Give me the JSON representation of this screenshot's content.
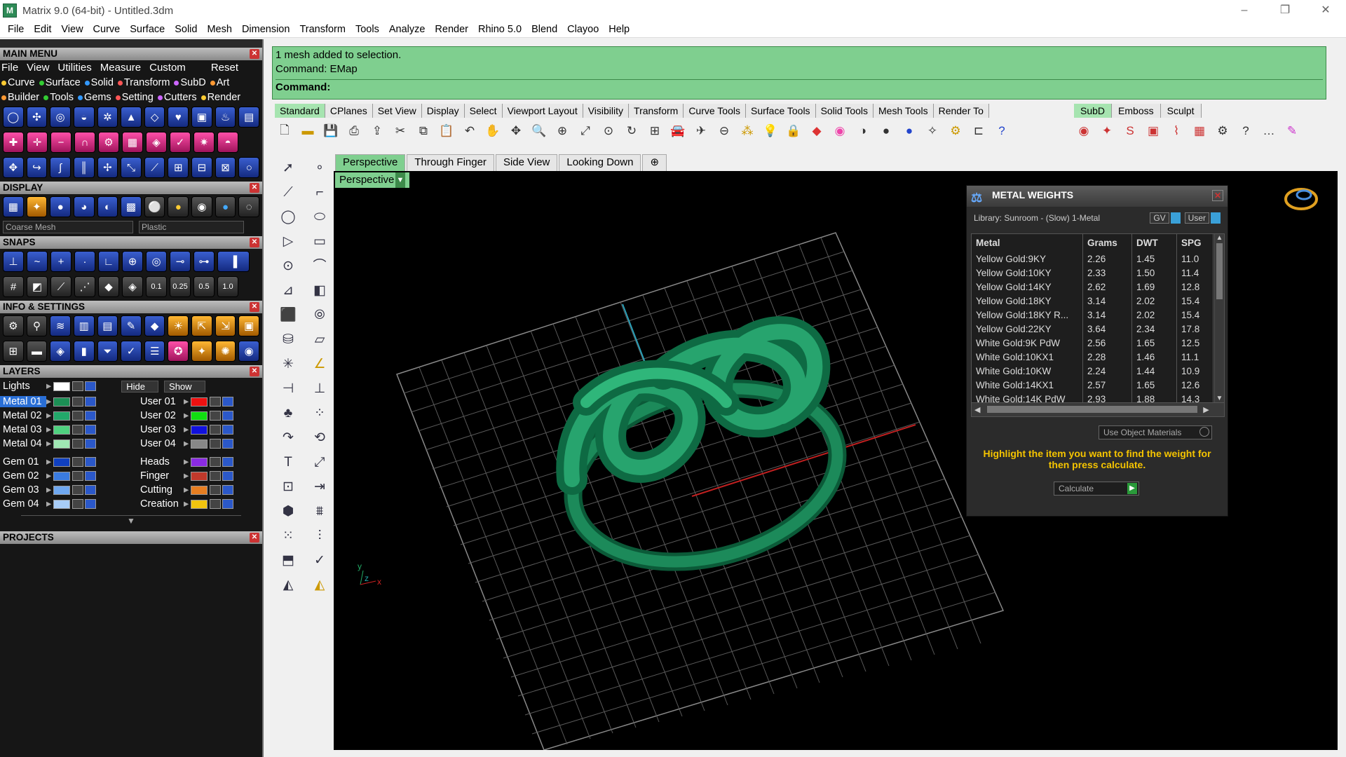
{
  "window": {
    "title": "Matrix 9.0 (64-bit) - Untitled.3dm"
  },
  "menus": [
    "File",
    "Edit",
    "View",
    "Curve",
    "Surface",
    "Solid",
    "Mesh",
    "Dimension",
    "Transform",
    "Tools",
    "Analyze",
    "Render",
    "Rhino 5.0",
    "Blend",
    "Clayoo",
    "Help"
  ],
  "left": {
    "main_menu": "MAIN MENU",
    "main_menu_items": [
      "File",
      "View",
      "Utilities",
      "Measure",
      "Custom",
      "Reset"
    ],
    "row2": [
      "Curve",
      "Surface",
      "Solid",
      "Transform",
      "SubD",
      "Art"
    ],
    "row3": [
      "Builder",
      "Tools",
      "Gems",
      "Setting",
      "Cutters",
      "Render"
    ],
    "display": "DISPLAY",
    "mesh_sel": "Coarse Mesh",
    "mat_sel": "Plastic",
    "snaps": "SNAPS",
    "snap_vals": [
      "0.1",
      "0.25",
      "0.5",
      "1.0"
    ],
    "info": "INFO & SETTINGS",
    "layers": "LAYERS",
    "lights": "Lights",
    "hide": "Hide",
    "show": "Show",
    "layers_left": [
      "Metal 01",
      "Metal 02",
      "Metal 03",
      "Metal 04",
      "Gem 01",
      "Gem 02",
      "Gem 03",
      "Gem 04"
    ],
    "layers_right": [
      "User 01",
      "User 02",
      "User 03",
      "User 04",
      "Heads",
      "Finger",
      "Cutting",
      "Creation"
    ],
    "projects": "PROJECTS"
  },
  "cmd": {
    "line1": "1 mesh added to selection.",
    "line2": "Command: EMap",
    "prompt": "Command:"
  },
  "tabs": [
    "Standard",
    "CPlanes",
    "Set View",
    "Display",
    "Select",
    "Viewport Layout",
    "Visibility",
    "Transform",
    "Curve Tools",
    "Surface Tools",
    "Solid Tools",
    "Mesh Tools",
    "Render To"
  ],
  "tabs2": [
    "SubD",
    "Emboss",
    "Sculpt"
  ],
  "vptabs": [
    "Perspective",
    "Through Finger",
    "Side View",
    "Looking Down"
  ],
  "vp_label": "Perspective",
  "mw": {
    "title": "METAL WEIGHTS",
    "library": "Library: Sunroom - (Slow) 1-Metal",
    "gv": "GV",
    "user": "User",
    "headers": [
      "Metal",
      "Grams",
      "DWT",
      "SPG"
    ],
    "rows": [
      [
        "Yellow Gold:9KY",
        "2.26",
        "1.45",
        "11.0"
      ],
      [
        "Yellow Gold:10KY",
        "2.33",
        "1.50",
        "11.4"
      ],
      [
        "Yellow Gold:14KY",
        "2.62",
        "1.69",
        "12.8"
      ],
      [
        "Yellow Gold:18KY",
        "3.14",
        "2.02",
        "15.4"
      ],
      [
        "Yellow Gold:18KY R...",
        "3.14",
        "2.02",
        "15.4"
      ],
      [
        "Yellow Gold:22KY",
        "3.64",
        "2.34",
        "17.8"
      ],
      [
        "White Gold:9K PdW",
        "2.56",
        "1.65",
        "12.5"
      ],
      [
        "White Gold:10KX1",
        "2.28",
        "1.46",
        "11.1"
      ],
      [
        "White Gold:10KW",
        "2.24",
        "1.44",
        "10.9"
      ],
      [
        "White Gold:14KX1",
        "2.57",
        "1.65",
        "12.6"
      ],
      [
        "White Gold:14K PdW",
        "2.93",
        "1.88",
        "14.3"
      ]
    ],
    "use_obj": "Use Object Materials",
    "message": "Highlight the item you want to find the weight for then press calculate.",
    "calculate": "Calculate"
  }
}
